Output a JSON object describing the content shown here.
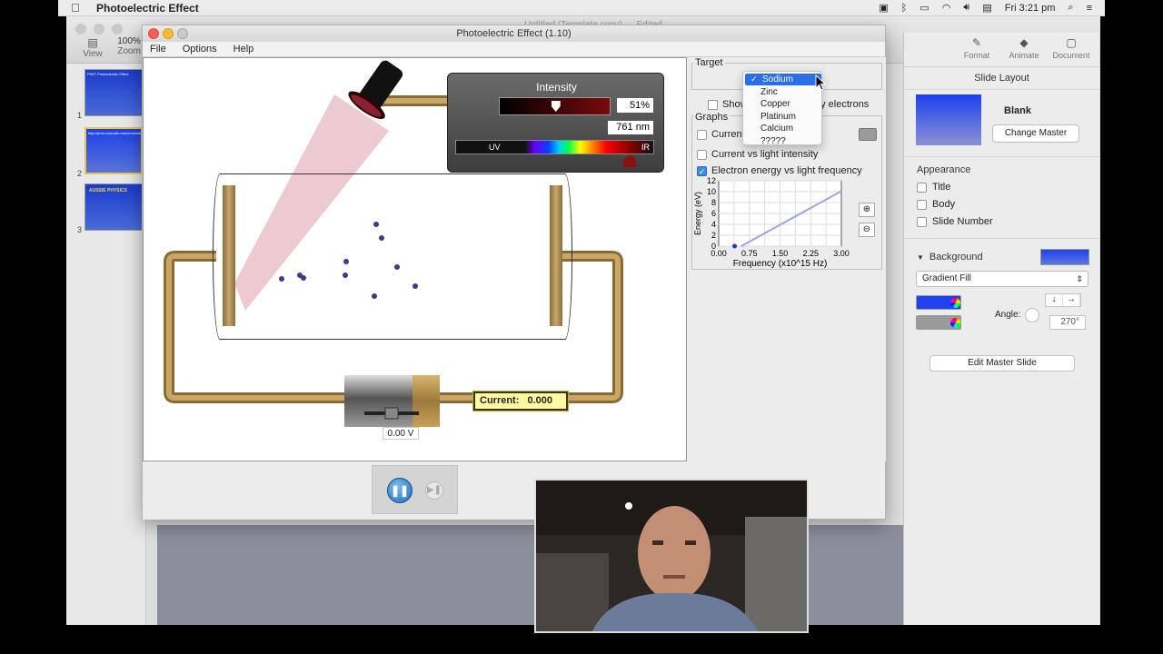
{
  "menubar": {
    "app_name": "Photoelectric Effect",
    "clock": "Fri 3:21 pm"
  },
  "keynote": {
    "doc_title": "Untitled (Template copy) — Edited",
    "toolbar": {
      "view": "View",
      "zoom": "Zoom",
      "zoom_value": "100%",
      "format": "Format",
      "animate": "Animate",
      "document": "Document"
    },
    "slides": [
      {
        "num": "1",
        "title": "PhET Photoelectric Effect"
      },
      {
        "num": "2",
        "title": "http://phet.colorado.edu/en/simulation/legacy/photoelectric"
      },
      {
        "num": "3",
        "title": "AUSSIE PHYSICS"
      }
    ],
    "inspector": {
      "section_title": "Slide Layout",
      "master_name": "Blank",
      "change_master": "Change Master",
      "appearance_label": "Appearance",
      "title_label": "Title",
      "body_label": "Body",
      "slide_number_label": "Slide Number",
      "background_label": "Background",
      "fill_type": "Gradient Fill",
      "angle_label": "Angle:",
      "angle_value": "270°",
      "edit_master": "Edit Master Slide",
      "color1": "#1f42ef",
      "color2": "#9a9a9a"
    }
  },
  "phet": {
    "window_title": "Photoelectric Effect (1.10)",
    "menu": {
      "file": "File",
      "options": "Options",
      "help": "Help"
    },
    "intensity": {
      "title": "Intensity",
      "value": "51%",
      "wavelength": "761 nm",
      "uv": "UV",
      "ir": "IR",
      "level": 0.51
    },
    "battery_voltage": "0.00 V",
    "current_label": "Current:",
    "current_value": "0.000",
    "target_label": "Target",
    "show_label": "Show",
    "show_rest": "gy electrons",
    "graphs_label": "Graphs",
    "graph_options": {
      "current_vs_voltage": "Current",
      "current_vs_voltage_rest": "e",
      "current_vs_intensity": "Current vs light intensity",
      "energy_vs_frequency": "Electron energy vs light frequency"
    },
    "target_menu": [
      {
        "label": "Sodium",
        "selected": true
      },
      {
        "label": "Zinc",
        "selected": false
      },
      {
        "label": "Copper",
        "selected": false
      },
      {
        "label": "Platinum",
        "selected": false
      },
      {
        "label": "Calcium",
        "selected": false
      },
      {
        "label": "?????",
        "selected": false
      }
    ],
    "check_mark": "✓"
  },
  "chart_data": {
    "type": "line",
    "ylabel": "Energy (eV)",
    "xlabel": "Frequency (x10^15 Hz)",
    "xlim": [
      0,
      3.0
    ],
    "ylim": [
      0,
      12
    ],
    "x_ticks": [
      "0.00",
      "0.75",
      "1.50",
      "2.25",
      "3.00"
    ],
    "y_ticks": [
      "0",
      "2",
      "4",
      "6",
      "8",
      "10",
      "12"
    ],
    "series": [
      {
        "x": [
          0.55,
          3.0
        ],
        "y": [
          0,
          10.1
        ]
      }
    ],
    "current_point": {
      "x": 0.39,
      "y": 0
    }
  }
}
